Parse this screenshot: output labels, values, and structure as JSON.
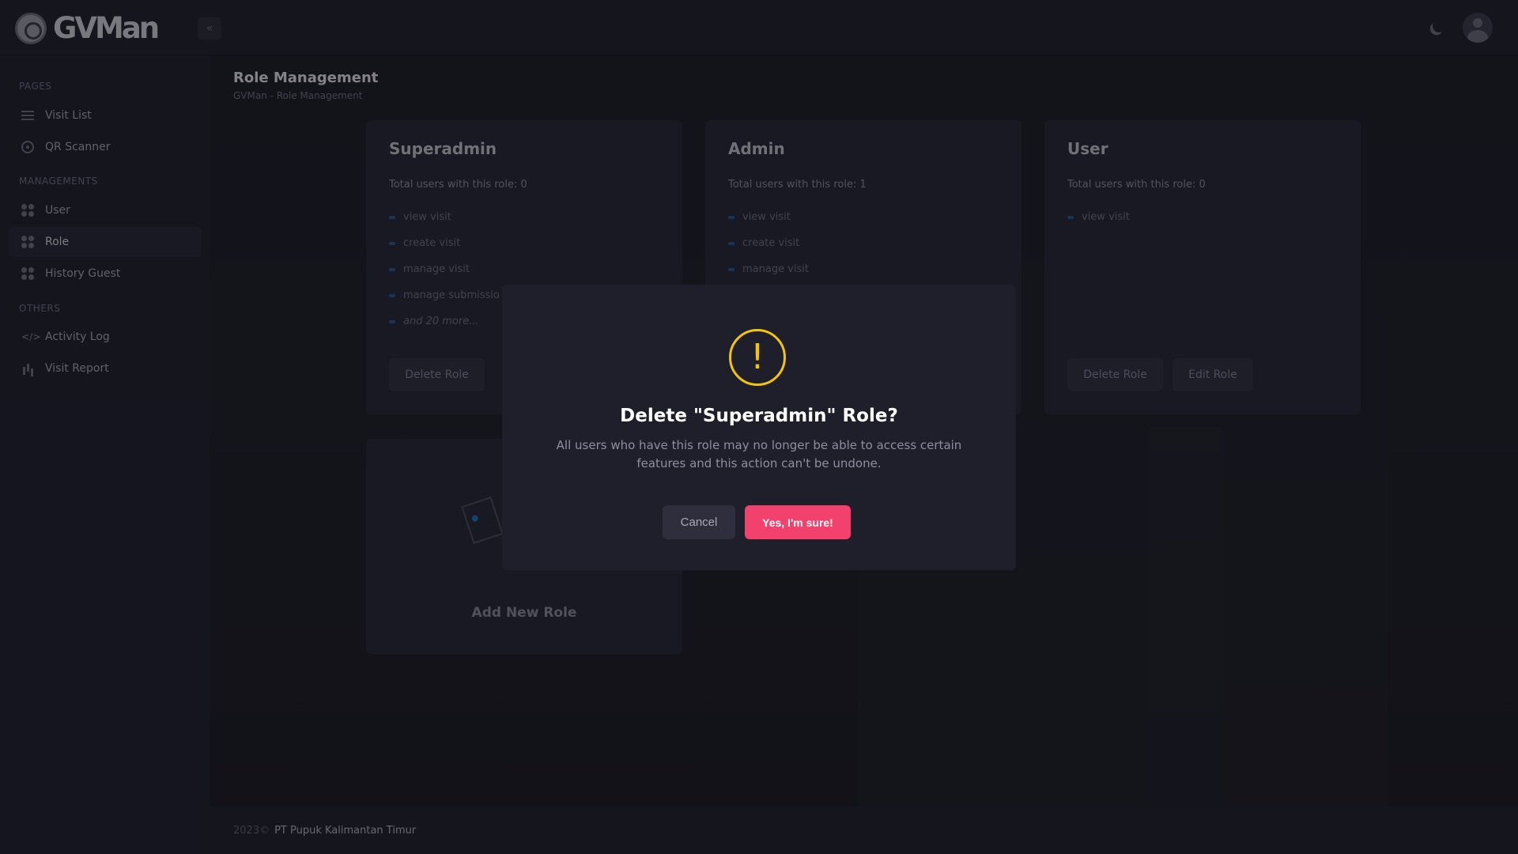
{
  "header": {
    "logo_text": "GVMan"
  },
  "sidebar": {
    "sections": [
      "PAGES",
      "MANAGEMENTS",
      "OTHERS"
    ],
    "items": [
      {
        "label": "Visit List"
      },
      {
        "label": "QR Scanner"
      },
      {
        "label": "User"
      },
      {
        "label": "Role"
      },
      {
        "label": "History Guest"
      },
      {
        "label": "Activity Log"
      },
      {
        "label": "Visit Report"
      }
    ]
  },
  "page": {
    "title": "Role Management",
    "breadcrumb": "GVMan - Role Management"
  },
  "roles": [
    {
      "name": "Superadmin",
      "count_text": "Total users with this role: 0",
      "permissions": [
        "view visit",
        "create visit",
        "manage visit",
        "manage submissio",
        "and 20 more..."
      ],
      "buttons": [
        "Delete Role"
      ]
    },
    {
      "name": "Admin",
      "count_text": "Total users with this role: 1",
      "permissions": [
        "view visit",
        "create visit",
        "manage visit"
      ]
    },
    {
      "name": "User",
      "count_text": "Total users with this role: 0",
      "permissions": [
        "view visit"
      ],
      "buttons": [
        "Delete Role",
        "Edit Role"
      ]
    }
  ],
  "add_role": {
    "label": "Add New Role"
  },
  "modal": {
    "title": "Delete \"Superadmin\" Role?",
    "text": "All users who have this role may no longer be able to access certain features and this action can't be undone.",
    "cancel_label": "Cancel",
    "confirm_label": "Yes, I'm sure!",
    "icon": "!"
  },
  "footer": {
    "year": "2023©",
    "company": "PT Pupuk Kalimantan Timur"
  },
  "colors": {
    "confirm": "#f1416c",
    "warning": "#f1c40f",
    "accent": "#1f5a96"
  }
}
